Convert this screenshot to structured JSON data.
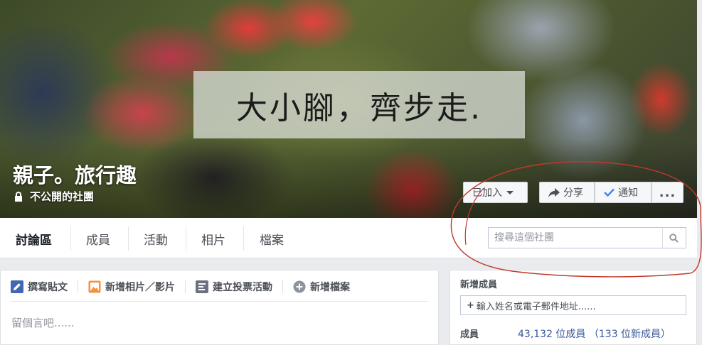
{
  "cover": {
    "banner_text": "大小腳，齊步走."
  },
  "group": {
    "name": "親子。旅行趣",
    "privacy": "不公開的社團"
  },
  "actions": {
    "joined": "已加入",
    "share": "分享",
    "notify": "通知",
    "more": "..."
  },
  "nav": {
    "tabs": [
      "討論區",
      "成員",
      "活動",
      "相片",
      "檔案"
    ],
    "active_tab": "討論區"
  },
  "search": {
    "placeholder": "搜尋這個社團"
  },
  "composer": {
    "actions": [
      "撰寫貼文",
      "新增相片／影片",
      "建立投票活動",
      "新增檔案"
    ],
    "placeholder": "留個言吧......"
  },
  "sidebar": {
    "add_members_title": "新增成員",
    "add_member_placeholder": "輸入姓名或電子郵件地址......",
    "members_label": "成員",
    "members_count": "43,132 位成員 （133 位新成員）"
  },
  "colors": {
    "link_blue": "#365899",
    "check_blue": "#4080ff",
    "annotation_red": "#c0392b"
  }
}
